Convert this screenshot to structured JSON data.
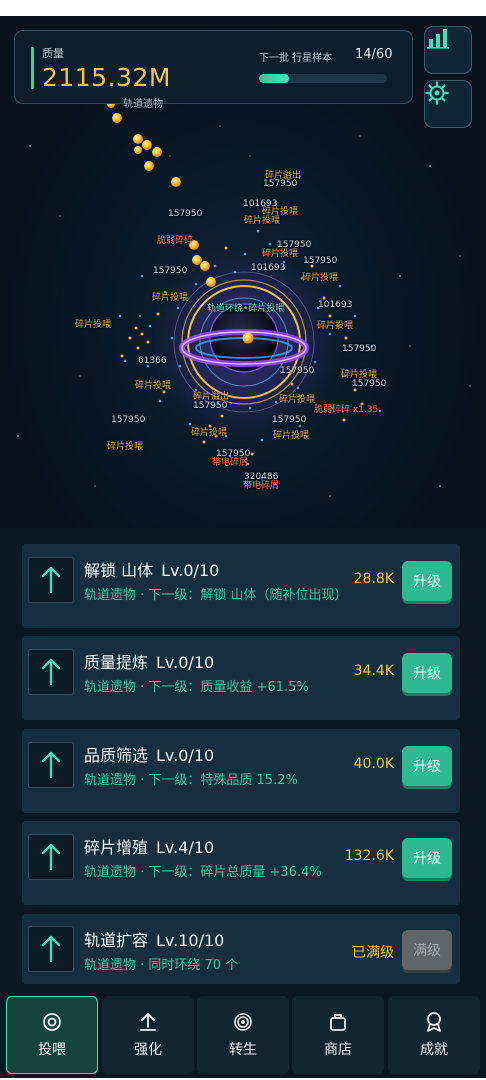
{
  "header": {
    "mass_label": "质量",
    "mass_value": "2115.32M",
    "mass_sub": "轨道遗物",
    "batch_label": "下一批 行星样本",
    "batch_count": "14/60",
    "batch_progress": 0.233,
    "stats_icon": "bar-chart-icon",
    "settings_icon": "gear-icon"
  },
  "floating": {
    "n157950": "157950",
    "n101693": "101693",
    "n61366": "61366",
    "n320486": "320486",
    "frag_feed": "碎片投喂",
    "frag_overflow": "碎片溢出",
    "fragile": "脆弱碎碎",
    "fragile_x135": "脆弱碎碎 x1.35",
    "charged": "带电碎屑",
    "ring_label": "轨道环绕•碎片投喂"
  },
  "upgrades": [
    {
      "title": "解锁 山体",
      "level": "Lv.0/10",
      "desc": "轨道遗物 · 下一级：解锁 山体（随补位出现）",
      "cost": "28.8K",
      "button": "升级",
      "icon": "arrow-up-icon"
    },
    {
      "title": "质量提炼",
      "level": "Lv.0/10",
      "desc": "轨道遗物 · 下一级：质量收益 +61.5%",
      "cost": "34.4K",
      "button": "升级",
      "icon": "arrow-up-icon"
    },
    {
      "title": "品质筛选",
      "level": "Lv.0/10",
      "desc": "轨道遗物 · 下一级：特殊品质 15.2%",
      "cost": "40.0K",
      "button": "升级",
      "icon": "arrow-up-icon"
    },
    {
      "title": "碎片增殖",
      "level": "Lv.4/10",
      "desc": "轨道遗物 · 下一级：碎片总质量 +36.4%",
      "cost": "132.6K",
      "button": "升级",
      "icon": "arrow-up-icon"
    },
    {
      "title": "轨道扩容",
      "level": "Lv.10/10",
      "desc": "轨道遗物 · 同时环绕 70 个",
      "cost": "已满级",
      "button": "满级",
      "icon": "arrow-up-icon"
    }
  ],
  "nav": [
    {
      "label": "投喂",
      "icon": "target-icon"
    },
    {
      "label": "强化",
      "icon": "upload-arrow-icon"
    },
    {
      "label": "转生",
      "icon": "spiral-icon"
    },
    {
      "label": "商店",
      "icon": "shop-bag-icon"
    },
    {
      "label": "成就",
      "icon": "medal-icon"
    }
  ],
  "colors": {
    "accent": "#2eb894",
    "gold": "#f5c242",
    "bg": "#081420",
    "card": "#15303c"
  }
}
